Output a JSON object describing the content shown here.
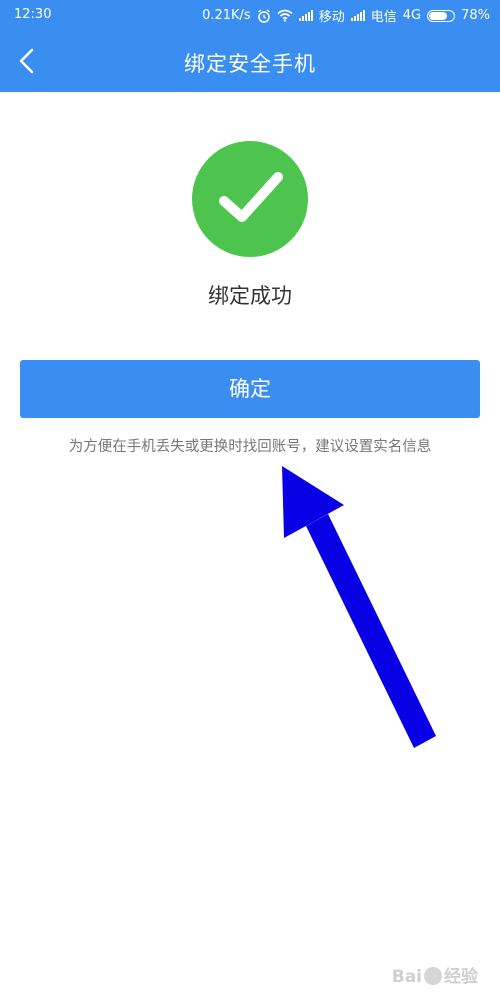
{
  "status_bar": {
    "time": "12:30",
    "net_speed": "0.21K/s",
    "carrier1": "移动",
    "carrier2": "电信",
    "network": "4G",
    "battery": "78%",
    "battery_level": 0.78
  },
  "header": {
    "title": "绑定安全手机"
  },
  "result": {
    "message": "绑定成功",
    "color": "#4cc44e"
  },
  "actions": {
    "confirm_label": "确定"
  },
  "hint": "为方便在手机丢失或更换时找回账号，建议设置实名信息",
  "annotation": {
    "arrow_color": "#0a00e6"
  },
  "watermark": {
    "brand_left": "Bai",
    "brand_right": "经验"
  },
  "theme": {
    "primary": "#3a8ef2"
  }
}
